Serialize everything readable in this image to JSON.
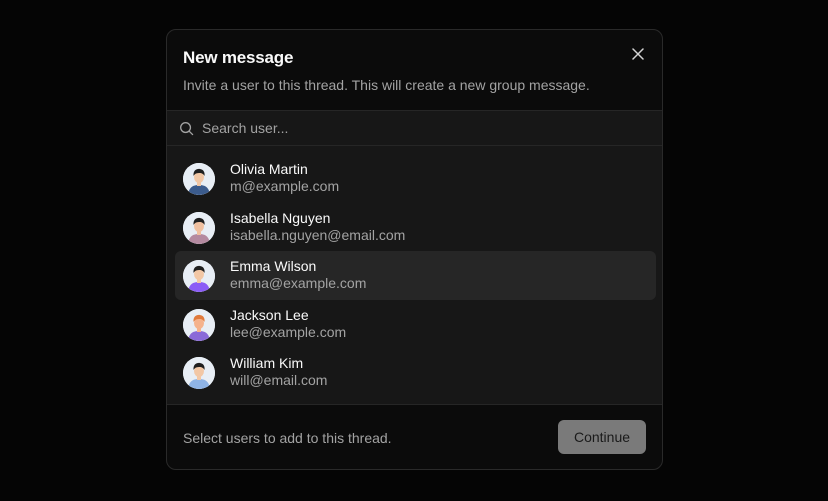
{
  "dialog": {
    "title": "New message",
    "subtitle": "Invite a user to this thread. This will create a new group message.",
    "close_icon": "close-icon"
  },
  "search": {
    "placeholder": "Search user...",
    "value": "",
    "icon": "search-icon"
  },
  "users": [
    {
      "name": "Olivia Martin",
      "email": "m@example.com",
      "selected": false,
      "shirt_color": "#3b5b8c",
      "skin_color": "#f2c7a5",
      "hair_color": "#1f1f1f"
    },
    {
      "name": "Isabella Nguyen",
      "email": "isabella.nguyen@email.com",
      "selected": false,
      "shirt_color": "#b48aa0",
      "skin_color": "#f0c0a0",
      "hair_color": "#1f1f1f"
    },
    {
      "name": "Emma Wilson",
      "email": "emma@example.com",
      "selected": true,
      "shirt_color": "#8b5cf6",
      "skin_color": "#f2c7a5",
      "hair_color": "#1f1f1f"
    },
    {
      "name": "Jackson Lee",
      "email": "lee@example.com",
      "selected": false,
      "shirt_color": "#8a6ad8",
      "skin_color": "#f5b28c",
      "hair_color": "#e07a3c"
    },
    {
      "name": "William Kim",
      "email": "will@email.com",
      "selected": false,
      "shirt_color": "#8fb4e6",
      "skin_color": "#f2c7a5",
      "hair_color": "#1f1f1f"
    }
  ],
  "footer": {
    "hint": "Select users to add to this thread.",
    "continue_label": "Continue"
  },
  "colors": {
    "background": "#0a0a0a",
    "panel": "#171717",
    "selected_row": "#262626",
    "button_disabled": "#7a7a7a"
  }
}
